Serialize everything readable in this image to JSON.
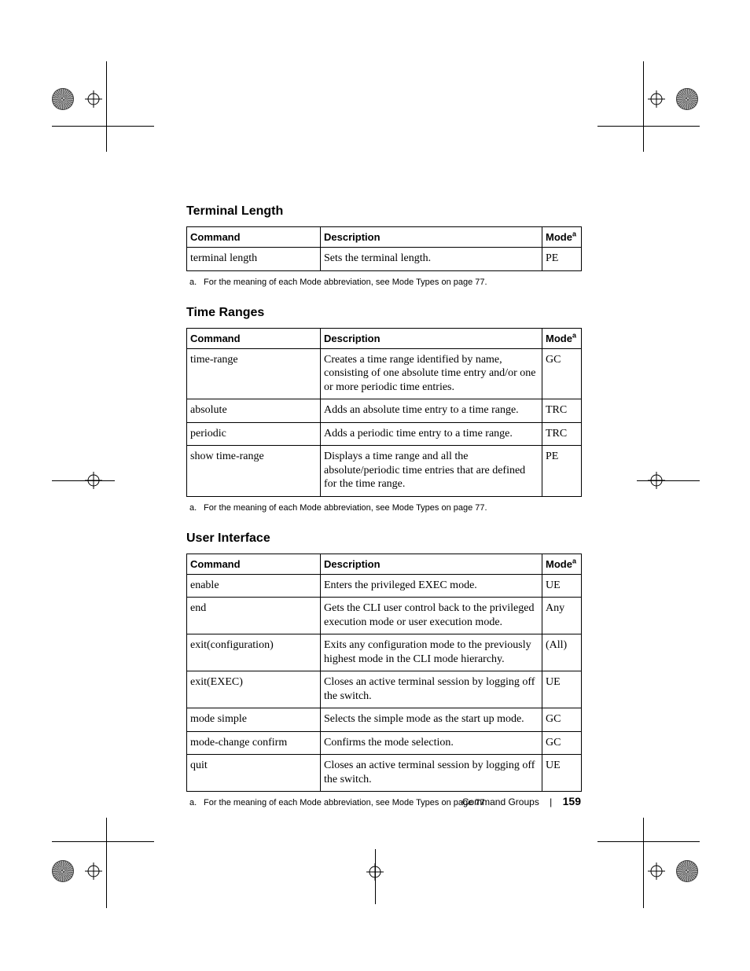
{
  "sections": [
    {
      "heading": "Terminal Length",
      "columns": {
        "c1": "Command",
        "c2": "Description",
        "c3": "Mode",
        "c3_sup": "a"
      },
      "rows": [
        {
          "cmd": "terminal length",
          "desc": "Sets the terminal length.",
          "mode": "PE"
        }
      ],
      "footnote_label": "a.",
      "footnote": "For the meaning of each Mode abbreviation, see Mode Types on page 77."
    },
    {
      "heading": "Time Ranges",
      "columns": {
        "c1": "Command",
        "c2": "Description",
        "c3": "Mode",
        "c3_sup": "a"
      },
      "rows": [
        {
          "cmd": "time-range",
          "desc": "Creates a time range identified by name, consisting of one absolute time entry and/or one or more periodic time entries.",
          "mode": "GC"
        },
        {
          "cmd": "absolute",
          "desc": "Adds an absolute time entry to a time range.",
          "mode": "TRC"
        },
        {
          "cmd": "periodic",
          "desc": "Adds a periodic time entry to a time range.",
          "mode": "TRC"
        },
        {
          "cmd": "show time-range",
          "desc": "Displays a time range and all the absolute/periodic time entries that are defined for the time range.",
          "mode": "PE"
        }
      ],
      "footnote_label": "a.",
      "footnote": "For the meaning of each Mode abbreviation, see Mode Types on page 77."
    },
    {
      "heading": "User Interface",
      "columns": {
        "c1": "Command",
        "c2": "Description",
        "c3": "Mode",
        "c3_sup": "a"
      },
      "rows": [
        {
          "cmd": "enable",
          "desc": "Enters the privileged EXEC mode.",
          "mode": "UE"
        },
        {
          "cmd": "end",
          "desc": "Gets the CLI user control back to the privileged execution mode or user execution mode.",
          "mode": "Any"
        },
        {
          "cmd": "exit(configuration)",
          "desc": "Exits any configuration mode to the previously highest mode in the CLI mode hierarchy.",
          "mode": "(All)"
        },
        {
          "cmd": "exit(EXEC)",
          "desc": "Closes an active terminal session by logging off the switch.",
          "mode": "UE"
        },
        {
          "cmd": "mode simple",
          "desc": "Selects the simple mode as the start up mode.",
          "mode": "GC"
        },
        {
          "cmd": "mode-change confirm",
          "desc": "Confirms the mode selection.",
          "mode": "GC"
        },
        {
          "cmd": "quit",
          "desc": "Closes an active terminal session by logging off the switch.",
          "mode": "UE"
        }
      ],
      "footnote_label": "a.",
      "footnote": "For the meaning of each Mode abbreviation, see Mode Types on page 77."
    }
  ],
  "footer": {
    "section": "Command Groups",
    "page": "159"
  }
}
